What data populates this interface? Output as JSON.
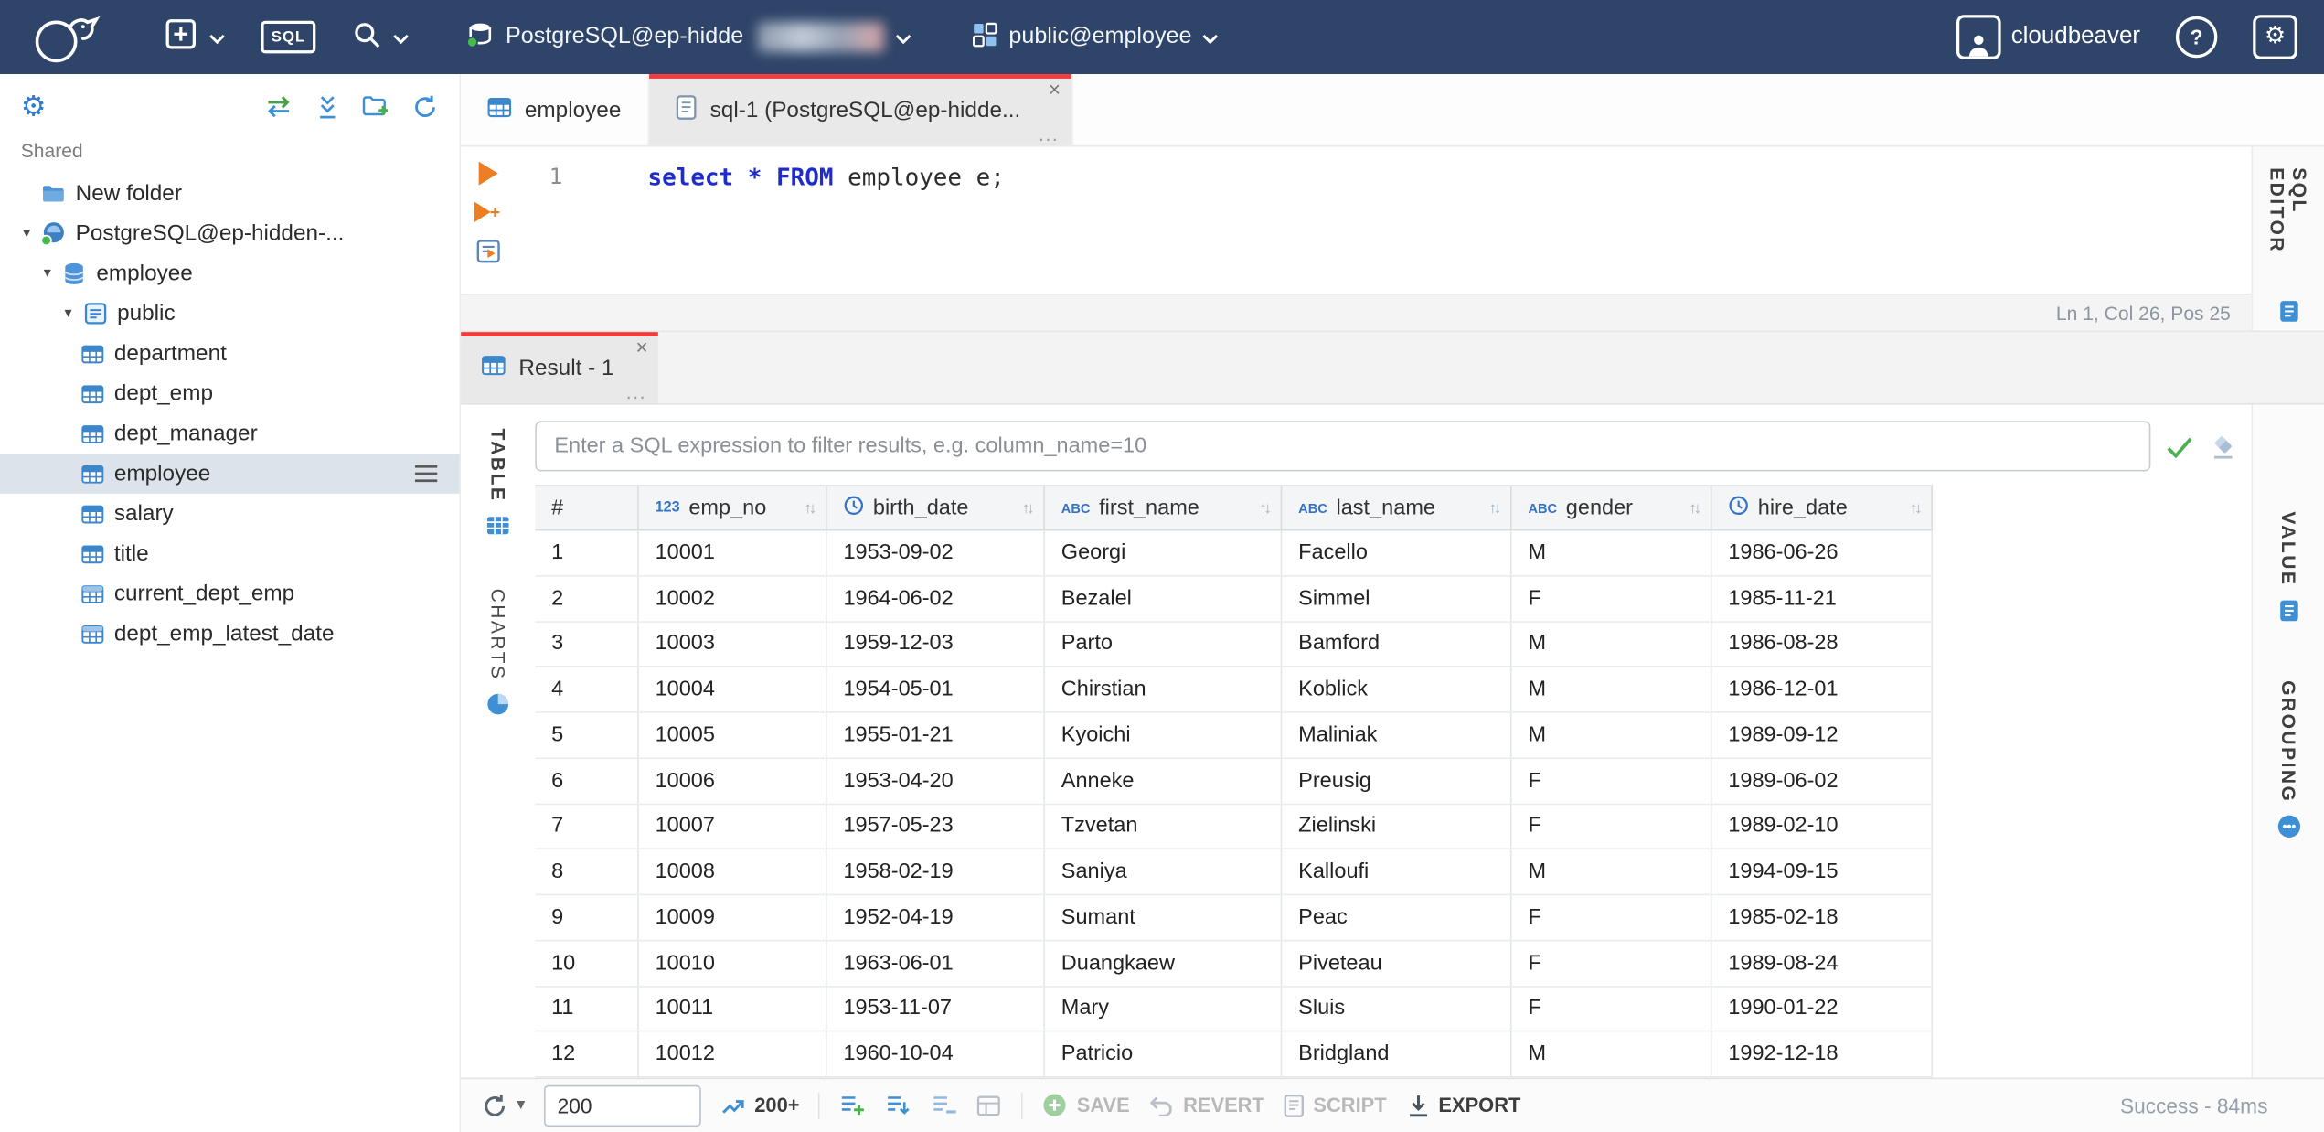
{
  "icons": {
    "sort": "↑↓",
    "chevron_down": "▾",
    "close": "×",
    "more": "...",
    "gear": "⚙",
    "question": "?"
  },
  "topbar": {
    "sql_button_label": "SQL",
    "connection_label": "PostgreSQL@ep-hidde",
    "schema_label": "public@employee",
    "user_label": "cloudbeaver"
  },
  "sidebar": {
    "section_label": "Shared",
    "tree": [
      {
        "label": "New folder"
      },
      {
        "label": "PostgreSQL@ep-hidden-..."
      },
      {
        "label": "employee"
      },
      {
        "label": "public"
      },
      {
        "label": "department"
      },
      {
        "label": "dept_emp"
      },
      {
        "label": "dept_manager"
      },
      {
        "label": "employee"
      },
      {
        "label": "salary"
      },
      {
        "label": "title"
      },
      {
        "label": "current_dept_emp"
      },
      {
        "label": "dept_emp_latest_date"
      }
    ]
  },
  "editor": {
    "tabs": [
      {
        "label": "employee"
      },
      {
        "label": "sql-1 (PostgreSQL@ep-hidde..."
      }
    ],
    "line_number": "1",
    "code": {
      "kw1": "select",
      "star": " * ",
      "kw2": "FROM",
      "rest": " employee e;"
    },
    "status": "Ln 1, Col 26, Pos 25",
    "side_tab": "SQL EDITOR"
  },
  "results": {
    "tab_label": "Result - 1",
    "filter_placeholder": "Enter a SQL expression to filter results, e.g. column_name=10",
    "left_tabs": {
      "table": "TABLE",
      "charts": "CHARTS"
    },
    "right_tabs": {
      "value": "VALUE",
      "grouping": "GROUPING"
    },
    "type_icons": {
      "number": "123",
      "string": "ABC"
    },
    "grid": {
      "columns": [
        {
          "name": "#"
        },
        {
          "name": "emp_no",
          "type": "number"
        },
        {
          "name": "birth_date",
          "type": "datetime"
        },
        {
          "name": "first_name",
          "type": "string"
        },
        {
          "name": "last_name",
          "type": "string"
        },
        {
          "name": "gender",
          "type": "string"
        },
        {
          "name": "hire_date",
          "type": "datetime"
        }
      ],
      "rows": [
        [
          "1",
          "10001",
          "1953-09-02",
          "Georgi",
          "Facello",
          "M",
          "1986-06-26"
        ],
        [
          "2",
          "10002",
          "1964-06-02",
          "Bezalel",
          "Simmel",
          "F",
          "1985-11-21"
        ],
        [
          "3",
          "10003",
          "1959-12-03",
          "Parto",
          "Bamford",
          "M",
          "1986-08-28"
        ],
        [
          "4",
          "10004",
          "1954-05-01",
          "Chirstian",
          "Koblick",
          "M",
          "1986-12-01"
        ],
        [
          "5",
          "10005",
          "1955-01-21",
          "Kyoichi",
          "Maliniak",
          "M",
          "1989-09-12"
        ],
        [
          "6",
          "10006",
          "1953-04-20",
          "Anneke",
          "Preusig",
          "F",
          "1989-06-02"
        ],
        [
          "7",
          "10007",
          "1957-05-23",
          "Tzvetan",
          "Zielinski",
          "F",
          "1989-02-10"
        ],
        [
          "8",
          "10008",
          "1958-02-19",
          "Saniya",
          "Kalloufi",
          "M",
          "1994-09-15"
        ],
        [
          "9",
          "10009",
          "1952-04-19",
          "Sumant",
          "Peac",
          "F",
          "1985-02-18"
        ],
        [
          "10",
          "10010",
          "1963-06-01",
          "Duangkaew",
          "Piveteau",
          "F",
          "1989-08-24"
        ],
        [
          "11",
          "10011",
          "1953-11-07",
          "Mary",
          "Sluis",
          "F",
          "1990-01-22"
        ],
        [
          "12",
          "10012",
          "1960-10-04",
          "Patricio",
          "Bridgland",
          "M",
          "1992-12-18"
        ]
      ]
    },
    "footer": {
      "fetch_size": "200",
      "fetch_page": "200+",
      "save": "SAVE",
      "revert": "REVERT",
      "script": "SCRIPT",
      "export": "EXPORT",
      "status": "Success - 84ms"
    }
  },
  "colors": {
    "topbar_bg": "#2e4469",
    "accent_red": "#f23b3b",
    "icon_blue": "#3e8fd4",
    "keyword_blue": "#1f2bcd",
    "success_green": "#4caf50"
  }
}
